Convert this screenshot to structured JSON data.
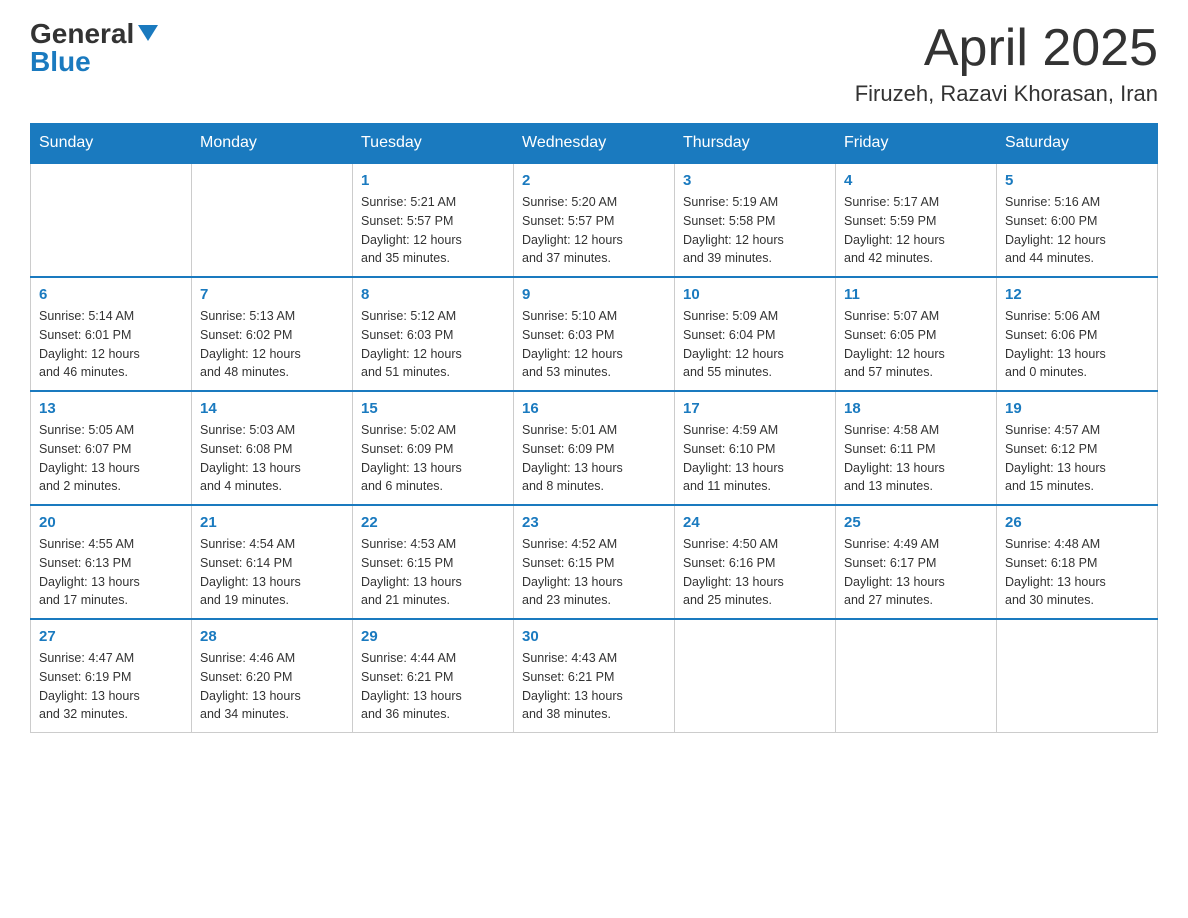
{
  "logo": {
    "general": "General",
    "blue": "Blue"
  },
  "header": {
    "month": "April 2025",
    "location": "Firuzeh, Razavi Khorasan, Iran"
  },
  "weekdays": [
    "Sunday",
    "Monday",
    "Tuesday",
    "Wednesday",
    "Thursday",
    "Friday",
    "Saturday"
  ],
  "weeks": [
    [
      {
        "day": "",
        "info": ""
      },
      {
        "day": "",
        "info": ""
      },
      {
        "day": "1",
        "info": "Sunrise: 5:21 AM\nSunset: 5:57 PM\nDaylight: 12 hours\nand 35 minutes."
      },
      {
        "day": "2",
        "info": "Sunrise: 5:20 AM\nSunset: 5:57 PM\nDaylight: 12 hours\nand 37 minutes."
      },
      {
        "day": "3",
        "info": "Sunrise: 5:19 AM\nSunset: 5:58 PM\nDaylight: 12 hours\nand 39 minutes."
      },
      {
        "day": "4",
        "info": "Sunrise: 5:17 AM\nSunset: 5:59 PM\nDaylight: 12 hours\nand 42 minutes."
      },
      {
        "day": "5",
        "info": "Sunrise: 5:16 AM\nSunset: 6:00 PM\nDaylight: 12 hours\nand 44 minutes."
      }
    ],
    [
      {
        "day": "6",
        "info": "Sunrise: 5:14 AM\nSunset: 6:01 PM\nDaylight: 12 hours\nand 46 minutes."
      },
      {
        "day": "7",
        "info": "Sunrise: 5:13 AM\nSunset: 6:02 PM\nDaylight: 12 hours\nand 48 minutes."
      },
      {
        "day": "8",
        "info": "Sunrise: 5:12 AM\nSunset: 6:03 PM\nDaylight: 12 hours\nand 51 minutes."
      },
      {
        "day": "9",
        "info": "Sunrise: 5:10 AM\nSunset: 6:03 PM\nDaylight: 12 hours\nand 53 minutes."
      },
      {
        "day": "10",
        "info": "Sunrise: 5:09 AM\nSunset: 6:04 PM\nDaylight: 12 hours\nand 55 minutes."
      },
      {
        "day": "11",
        "info": "Sunrise: 5:07 AM\nSunset: 6:05 PM\nDaylight: 12 hours\nand 57 minutes."
      },
      {
        "day": "12",
        "info": "Sunrise: 5:06 AM\nSunset: 6:06 PM\nDaylight: 13 hours\nand 0 minutes."
      }
    ],
    [
      {
        "day": "13",
        "info": "Sunrise: 5:05 AM\nSunset: 6:07 PM\nDaylight: 13 hours\nand 2 minutes."
      },
      {
        "day": "14",
        "info": "Sunrise: 5:03 AM\nSunset: 6:08 PM\nDaylight: 13 hours\nand 4 minutes."
      },
      {
        "day": "15",
        "info": "Sunrise: 5:02 AM\nSunset: 6:09 PM\nDaylight: 13 hours\nand 6 minutes."
      },
      {
        "day": "16",
        "info": "Sunrise: 5:01 AM\nSunset: 6:09 PM\nDaylight: 13 hours\nand 8 minutes."
      },
      {
        "day": "17",
        "info": "Sunrise: 4:59 AM\nSunset: 6:10 PM\nDaylight: 13 hours\nand 11 minutes."
      },
      {
        "day": "18",
        "info": "Sunrise: 4:58 AM\nSunset: 6:11 PM\nDaylight: 13 hours\nand 13 minutes."
      },
      {
        "day": "19",
        "info": "Sunrise: 4:57 AM\nSunset: 6:12 PM\nDaylight: 13 hours\nand 15 minutes."
      }
    ],
    [
      {
        "day": "20",
        "info": "Sunrise: 4:55 AM\nSunset: 6:13 PM\nDaylight: 13 hours\nand 17 minutes."
      },
      {
        "day": "21",
        "info": "Sunrise: 4:54 AM\nSunset: 6:14 PM\nDaylight: 13 hours\nand 19 minutes."
      },
      {
        "day": "22",
        "info": "Sunrise: 4:53 AM\nSunset: 6:15 PM\nDaylight: 13 hours\nand 21 minutes."
      },
      {
        "day": "23",
        "info": "Sunrise: 4:52 AM\nSunset: 6:15 PM\nDaylight: 13 hours\nand 23 minutes."
      },
      {
        "day": "24",
        "info": "Sunrise: 4:50 AM\nSunset: 6:16 PM\nDaylight: 13 hours\nand 25 minutes."
      },
      {
        "day": "25",
        "info": "Sunrise: 4:49 AM\nSunset: 6:17 PM\nDaylight: 13 hours\nand 27 minutes."
      },
      {
        "day": "26",
        "info": "Sunrise: 4:48 AM\nSunset: 6:18 PM\nDaylight: 13 hours\nand 30 minutes."
      }
    ],
    [
      {
        "day": "27",
        "info": "Sunrise: 4:47 AM\nSunset: 6:19 PM\nDaylight: 13 hours\nand 32 minutes."
      },
      {
        "day": "28",
        "info": "Sunrise: 4:46 AM\nSunset: 6:20 PM\nDaylight: 13 hours\nand 34 minutes."
      },
      {
        "day": "29",
        "info": "Sunrise: 4:44 AM\nSunset: 6:21 PM\nDaylight: 13 hours\nand 36 minutes."
      },
      {
        "day": "30",
        "info": "Sunrise: 4:43 AM\nSunset: 6:21 PM\nDaylight: 13 hours\nand 38 minutes."
      },
      {
        "day": "",
        "info": ""
      },
      {
        "day": "",
        "info": ""
      },
      {
        "day": "",
        "info": ""
      }
    ]
  ]
}
